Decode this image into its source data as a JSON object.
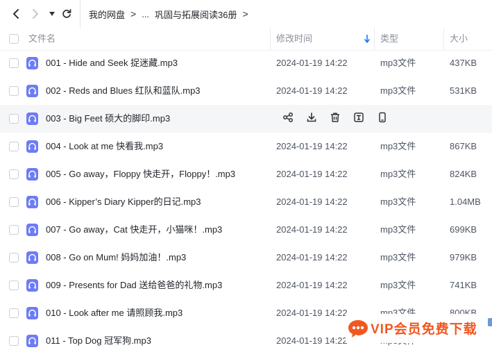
{
  "breadcrumb": {
    "root": "我的网盘",
    "ellipsis": "...",
    "current": "巩固与拓展阅读36册"
  },
  "columns": {
    "name": "文件名",
    "modified": "修改时间",
    "type": "类型",
    "size": "大小"
  },
  "files": [
    {
      "name": "001 - Hide and Seek 捉迷藏.mp3",
      "modified": "2024-01-19 14:22",
      "type": "mp3文件",
      "size": "437KB"
    },
    {
      "name": "002 - Reds and Blues 红队和蓝队.mp3",
      "modified": "2024-01-19 14:22",
      "type": "mp3文件",
      "size": "531KB"
    },
    {
      "name": "003 - Big Feet 硕大的脚印.mp3",
      "modified": "",
      "type": "",
      "size": "",
      "hovered": true
    },
    {
      "name": "004 - Look at me 快看我.mp3",
      "modified": "2024-01-19 14:22",
      "type": "mp3文件",
      "size": "867KB"
    },
    {
      "name": "005 - Go away，Floppy 快走开，Floppy！.mp3",
      "modified": "2024-01-19 14:22",
      "type": "mp3文件",
      "size": "824KB"
    },
    {
      "name": "006 - Kipper’s Diary Kipper的日记.mp3",
      "modified": "2024-01-19 14:22",
      "type": "mp3文件",
      "size": "1.04MB"
    },
    {
      "name": "007 - Go away，Cat 快走开，小猫咪！.mp3",
      "modified": "2024-01-19 14:22",
      "type": "mp3文件",
      "size": "699KB"
    },
    {
      "name": "008 - Go on Mum! 妈妈加油！.mp3",
      "modified": "2024-01-19 14:22",
      "type": "mp3文件",
      "size": "979KB"
    },
    {
      "name": "009 - Presents for Dad 送给爸爸的礼物.mp3",
      "modified": "2024-01-19 14:22",
      "type": "mp3文件",
      "size": "741KB"
    },
    {
      "name": "010 - Look after me 请照顾我.mp3",
      "modified": "2024-01-19 14:22",
      "type": "mp3文件",
      "size": "800KB"
    },
    {
      "name": "011 - Top Dog 冠军狗.mp3",
      "modified": "2024-01-19 14:22",
      "type": "mp3文件",
      "size": ""
    }
  ],
  "row_actions": [
    "share-icon",
    "download-icon",
    "delete-icon",
    "rename-icon",
    "phone-icon"
  ],
  "overlay": {
    "promo_text": "VIP会员免费下载"
  },
  "colors": {
    "accent": "#1677ff",
    "file_icon": "#6d7cf5",
    "promo": "#f2571f",
    "hover_row": "#f5f6f8"
  }
}
